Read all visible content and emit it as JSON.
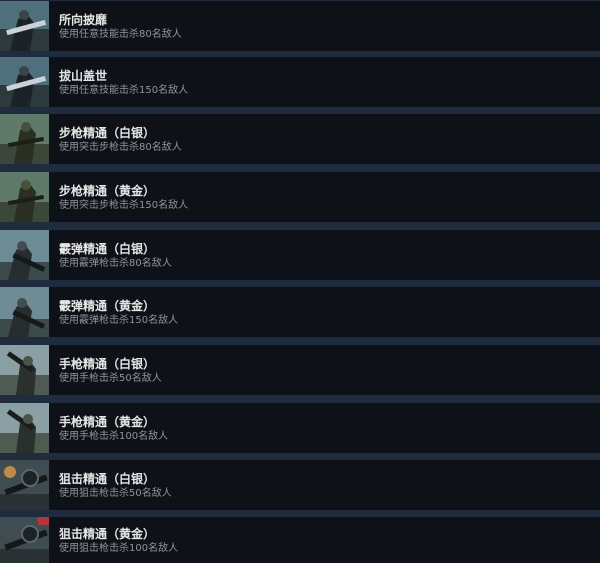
{
  "achievements": [
    {
      "title": "所向披靡",
      "desc": "使用任意技能击杀80名敌人",
      "icon": "machine-gunner-icon"
    },
    {
      "title": "拔山盖世",
      "desc": "使用任意技能击杀150名敌人",
      "icon": "machine-gunner-icon"
    },
    {
      "title": "步枪精通（白银）",
      "desc": "使用突击步枪击杀80名敌人",
      "icon": "rifleman-icon"
    },
    {
      "title": "步枪精通（黄金）",
      "desc": "使用突击步枪击杀150名敌人",
      "icon": "rifleman-icon"
    },
    {
      "title": "霰弹精通（白银）",
      "desc": "使用霰弹枪击杀80名敌人",
      "icon": "shotgunner-icon"
    },
    {
      "title": "霰弹精通（黄金）",
      "desc": "使用霰弹枪击杀150名敌人",
      "icon": "shotgunner-icon"
    },
    {
      "title": "手枪精通（白银）",
      "desc": "使用手枪击杀50名敌人",
      "icon": "pistol-soldier-icon"
    },
    {
      "title": "手枪精通（黄金）",
      "desc": "使用手枪击杀100名敌人",
      "icon": "pistol-soldier-icon"
    },
    {
      "title": "狙击精通（白银）",
      "desc": "使用狙击枪击杀50名敌人",
      "icon": "sniper-scope-icon"
    },
    {
      "title": "狙击精通（黄金）",
      "desc": "使用狙击枪击杀100名敌人",
      "icon": "sniper-scope-icon"
    }
  ]
}
